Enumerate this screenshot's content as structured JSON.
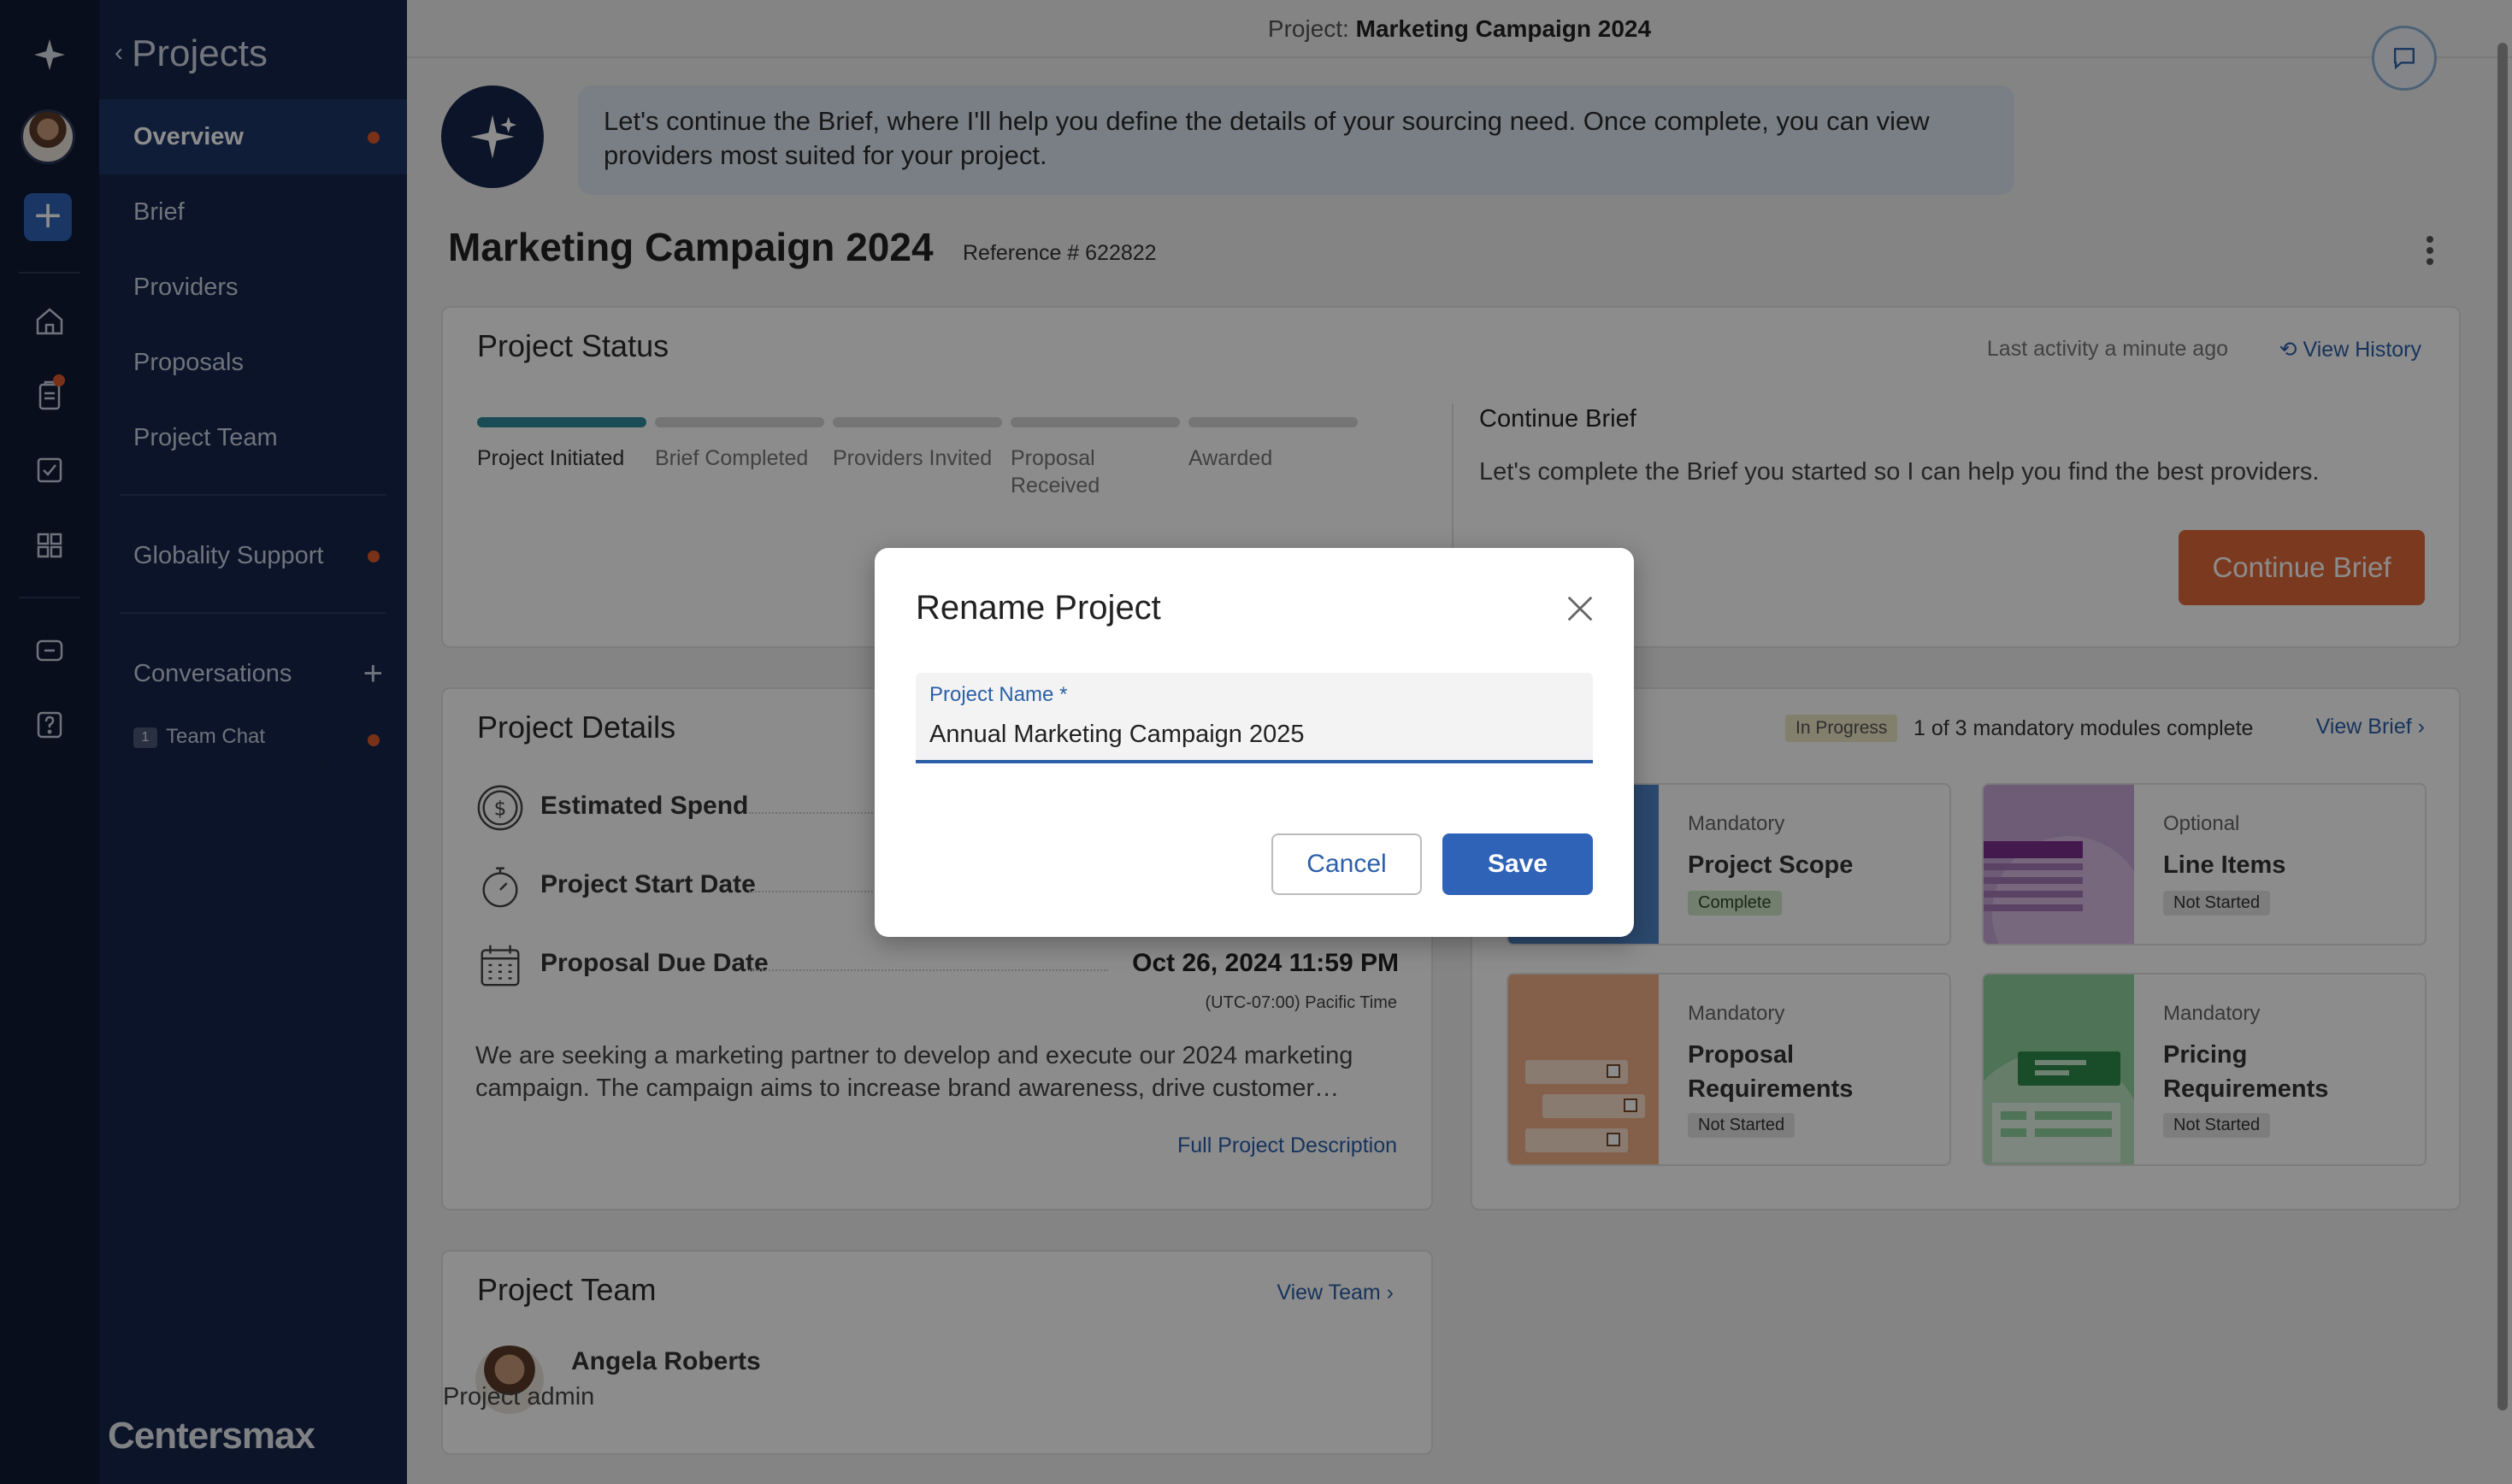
{
  "rail": {
    "icons": [
      "spark-icon",
      "home-icon",
      "clipboard-icon",
      "check-square-icon",
      "grid-icon",
      "chat-bubble-icon",
      "help-icon"
    ],
    "add_label": "+"
  },
  "nav": {
    "back_label": "Projects",
    "items": [
      {
        "label": "Overview"
      },
      {
        "label": "Brief"
      },
      {
        "label": "Providers"
      },
      {
        "label": "Proposals"
      },
      {
        "label": "Project Team"
      },
      {
        "label": "Globality Support"
      },
      {
        "label": "Conversations"
      }
    ],
    "chat_badge": "1",
    "chat_label": "Team Chat",
    "logo": "Centersmax"
  },
  "topbar": {
    "prefix": "Project:",
    "project_name": "Marketing Campaign 2024"
  },
  "assistant": {
    "message": "Let's continue the Brief, where I'll help you define the details of your sourcing need. Once complete, you can view providers most suited for your project."
  },
  "project": {
    "title": "Marketing Campaign 2024",
    "reference": "Reference # 622822"
  },
  "status": {
    "heading": "Project Status",
    "last_activity": "Last activity a minute ago",
    "view_history": "View History",
    "steps": [
      {
        "label": "Project Initiated"
      },
      {
        "label": "Brief Completed"
      },
      {
        "label": "Providers Invited"
      },
      {
        "label": "Proposal Received"
      },
      {
        "label": "Awarded"
      }
    ],
    "completed_steps": 1,
    "continue_heading": "Continue Brief",
    "continue_text": "Let's complete the Brief you started so I can help you find the best providers.",
    "continue_button": "Continue Brief"
  },
  "details": {
    "heading": "Project Details",
    "rows": [
      {
        "label": "Estimated Spend",
        "value": ""
      },
      {
        "label": "Project Start Date",
        "value": ""
      },
      {
        "label": "Proposal Due Date",
        "value": "Oct 26, 2024 11:59 PM"
      }
    ],
    "timezone": "(UTC-07:00) Pacific Time",
    "description": "We are seeking a marketing partner to develop and execute our 2024 marketing campaign. The campaign aims to increase brand awareness, drive customer…",
    "full_description": "Full Project Description"
  },
  "modules": {
    "badge": "In Progress",
    "status": "1 of 3 mandatory modules complete",
    "view_brief": "View Brief",
    "items": [
      {
        "type": "Mandatory",
        "name": "Project Scope",
        "state": "Complete"
      },
      {
        "type": "Optional",
        "name": "Line Items",
        "state": "Not Started"
      },
      {
        "type": "Mandatory",
        "name": "Proposal Requirements",
        "state": "Not Started"
      },
      {
        "type": "Mandatory",
        "name": "Pricing Requirements",
        "state": "Not Started"
      }
    ]
  },
  "team": {
    "heading": "Project Team",
    "view_team": "View Team",
    "member_name": "Angela Roberts",
    "member_role": "Project admin"
  },
  "modal": {
    "title": "Rename Project",
    "field_label": "Project Name",
    "required_mark": "*",
    "field_value": "Annual Marketing Campaign 2025",
    "cancel": "Cancel",
    "save": "Save"
  },
  "colors": {
    "rail_bg": "#0f1a33",
    "nav_bg": "#15254a",
    "accent_blue": "#2f63b7",
    "orange": "#e06a3a",
    "progress_teal": "#2e8a9a"
  }
}
